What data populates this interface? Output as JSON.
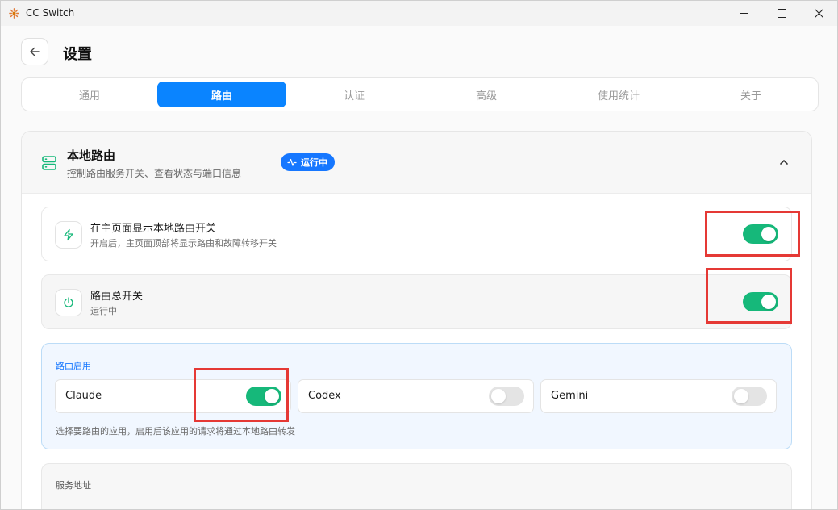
{
  "window": {
    "title": "CC Switch",
    "minimize_icon": "minimize-icon",
    "maximize_icon": "maximize-icon",
    "close_icon": "close-icon"
  },
  "header": {
    "back_icon": "arrow-left-icon",
    "title": "设置"
  },
  "tabs": [
    {
      "label": "通用",
      "active": false
    },
    {
      "label": "路由",
      "active": true
    },
    {
      "label": "认证",
      "active": false
    },
    {
      "label": "高级",
      "active": false
    },
    {
      "label": "使用统计",
      "active": false
    },
    {
      "label": "关于",
      "active": false
    }
  ],
  "section": {
    "icon": "server-icon",
    "title": "本地路由",
    "description": "控制路由服务开关、查看状态与端口信息",
    "status_badge": "运行中",
    "collapse_icon": "chevron-up-icon"
  },
  "settings": {
    "show_switch": {
      "icon": "lightning-icon",
      "title": "在主页面显示本地路由开关",
      "description": "开启后，主页面顶部将显示路由和故障转移开关",
      "enabled": true
    },
    "master_switch": {
      "icon": "power-icon",
      "title": "路由总开关",
      "description": "运行中",
      "enabled": true
    }
  },
  "route_enable": {
    "label": "路由启用",
    "apps": [
      {
        "name": "Claude",
        "enabled": true
      },
      {
        "name": "Codex",
        "enabled": false
      },
      {
        "name": "Gemini",
        "enabled": false
      }
    ],
    "hint": "选择要路由的应用，启用后该应用的请求将通过本地路由转发"
  },
  "service": {
    "label": "服务地址"
  },
  "colors": {
    "accent": "#0a84ff",
    "toggle_on": "#16b87a",
    "highlight": "#e53935"
  }
}
